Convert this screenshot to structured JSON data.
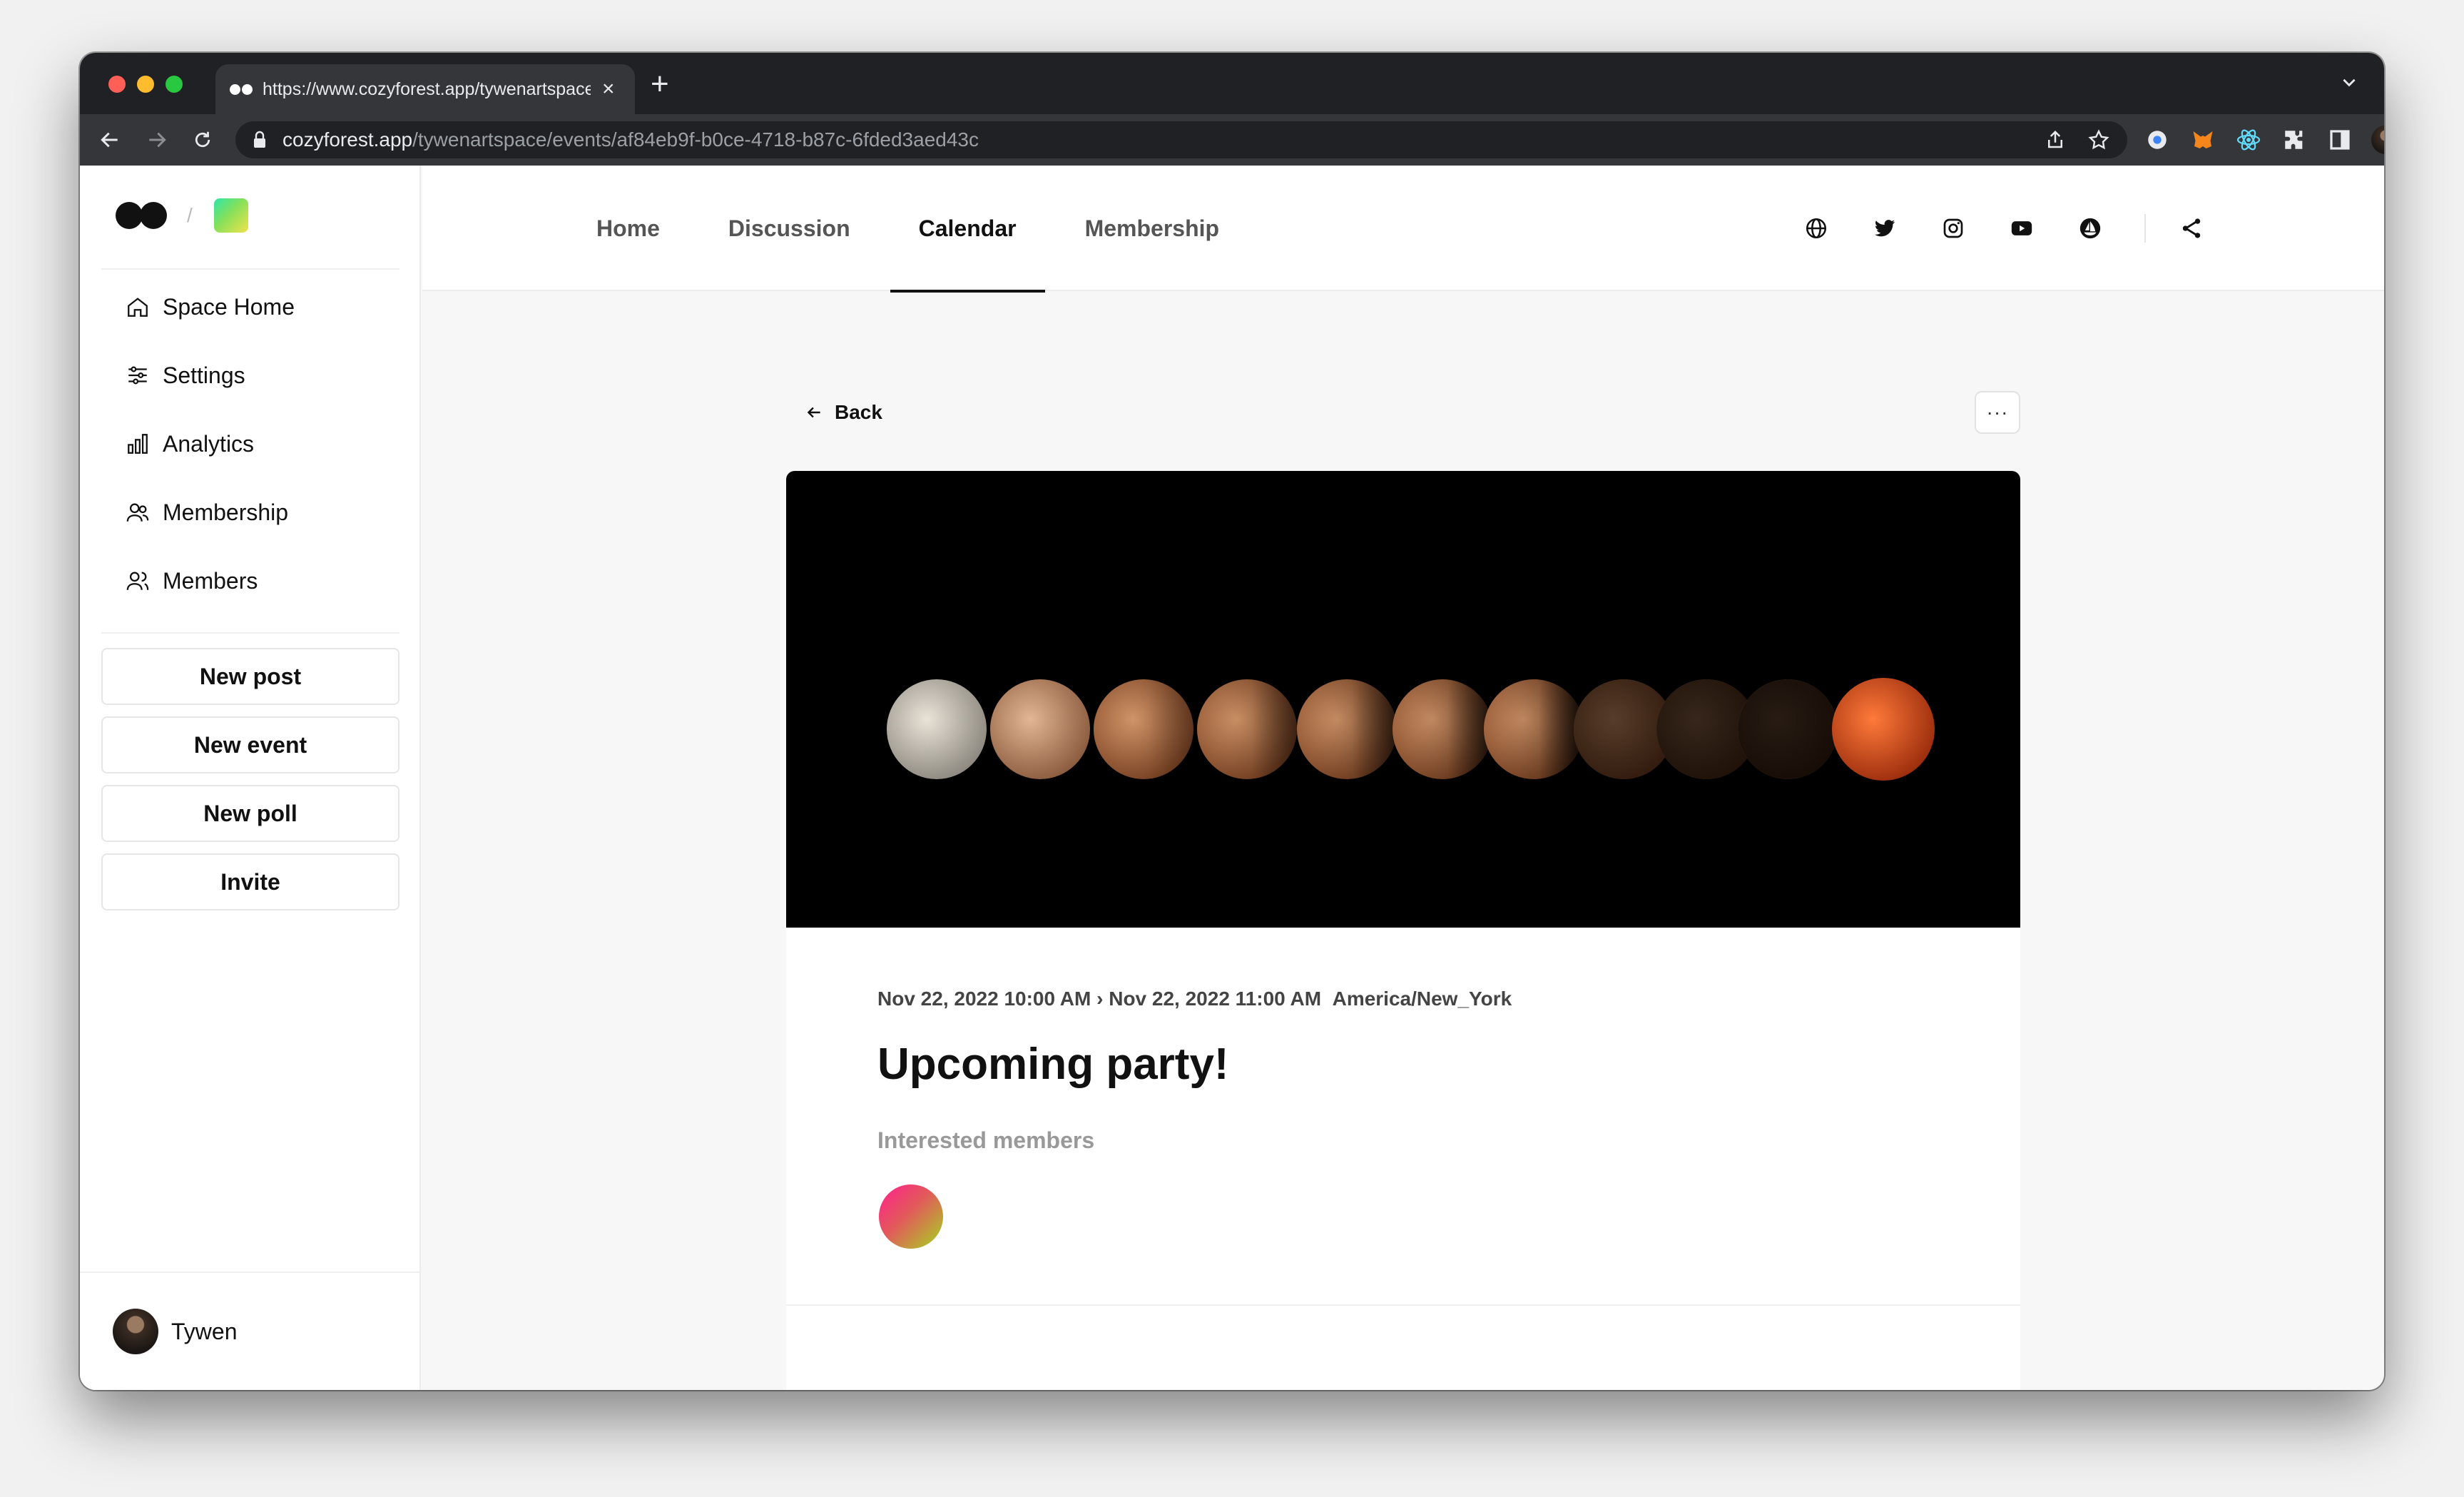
{
  "browser": {
    "tab_title": "https://www.cozyforest.app/tywenartspace/events/af84eb9f",
    "url_host": "cozyforest.app",
    "url_path": "/tywenartspace/events/af84eb9f-b0ce-4718-b87c-6fded3aed43c"
  },
  "sidebar": {
    "nav": [
      "Space Home",
      "Settings",
      "Analytics",
      "Membership",
      "Members"
    ],
    "actions": [
      "New post",
      "New event",
      "New poll",
      "Invite"
    ],
    "user_name": "Tywen"
  },
  "topnav": {
    "tabs": [
      "Home",
      "Discussion",
      "Calendar",
      "Membership"
    ],
    "active_tab": "Calendar",
    "social_icons": [
      "globe-icon",
      "twitter-icon",
      "instagram-icon",
      "youtube-icon",
      "opensea-icon",
      "share-icon"
    ]
  },
  "event": {
    "back_label": "Back",
    "more_label": "···",
    "date_range": "Nov 22, 2022 10:00 AM › Nov 22, 2022 11:00 AM",
    "timezone": "America/New_York",
    "title": "Upcoming party!",
    "interested_label": "Interested members",
    "banner_alt": "lunar eclipse phases"
  }
}
